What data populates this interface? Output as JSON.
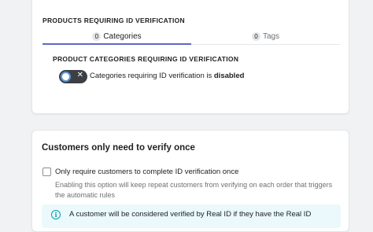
{
  "id_verification_card": {
    "section_heading": "PRODUCTS REQUIRING ID VERIFICATION",
    "tabs": [
      {
        "count": "0",
        "label": "Categories"
      },
      {
        "count": "0",
        "label": "Tags"
      }
    ],
    "panel_heading": "PRODUCT CATEGORIES REQUIRING ID VERIFICATION",
    "toggle": {
      "label_prefix": "Categories requiring ID verification is",
      "label_state": "disabled",
      "toggle_icon": "x-icon"
    }
  },
  "verify_once_card": {
    "title": "Customers only need to verify once",
    "checkbox_label": "Only require customers to complete ID verification once",
    "help_text": "Enabling this option will keep repeat customers from verifying on each order that triggers the automatic rules",
    "banner": {
      "icon": "info-icon",
      "text": "A customer will be considered verified by Real ID if they have the Real ID"
    }
  },
  "colors": {
    "accent": "#5c6ac4",
    "toggle_bg": "#3c3f45",
    "banner_bg": "#ebf9fc",
    "info": "#00a0ac"
  }
}
